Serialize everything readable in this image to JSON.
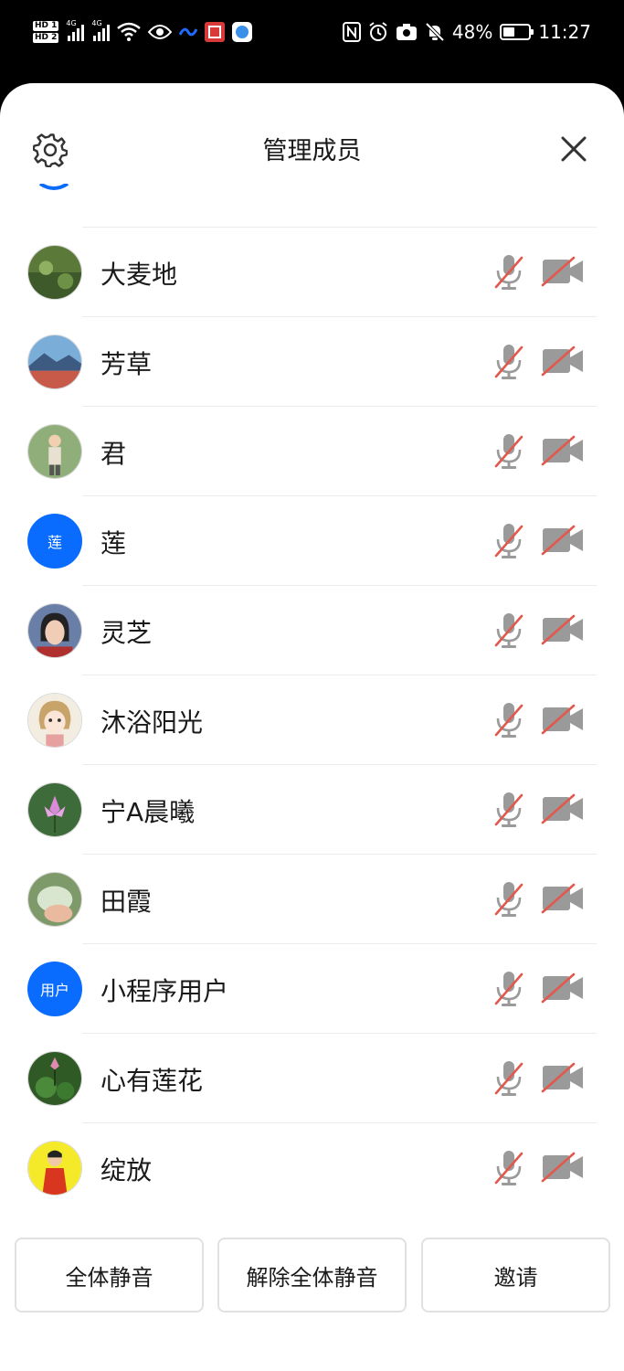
{
  "status_bar": {
    "hd1": "HD 1",
    "hd2": "HD 2",
    "net1": "4G",
    "net2": "4G",
    "battery": "48%",
    "battery_level": 0.48,
    "time": "11:27",
    "icons": [
      "wifi-icon",
      "eye-icon",
      "nfc-icon",
      "alarm-icon",
      "camera-icon",
      "mute-bell-icon"
    ]
  },
  "sheet": {
    "title": "管理成员",
    "settings_icon": "gear-icon",
    "close_icon": "close-icon"
  },
  "members": [
    {
      "name": "大麦地",
      "avatar": "photo",
      "avatar_text": ""
    },
    {
      "name": "芳草",
      "avatar": "photo",
      "avatar_text": ""
    },
    {
      "name": "君",
      "avatar": "photo",
      "avatar_text": ""
    },
    {
      "name": "莲",
      "avatar": "text",
      "avatar_text": "莲"
    },
    {
      "name": "灵芝",
      "avatar": "photo",
      "avatar_text": ""
    },
    {
      "name": "沐浴阳光",
      "avatar": "photo",
      "avatar_text": ""
    },
    {
      "name": "宁A晨曦",
      "avatar": "photo",
      "avatar_text": ""
    },
    {
      "name": "田霞",
      "avatar": "photo",
      "avatar_text": ""
    },
    {
      "name": "小程序用户",
      "avatar": "text",
      "avatar_text": "用户"
    },
    {
      "name": "心有莲花",
      "avatar": "photo",
      "avatar_text": ""
    },
    {
      "name": "绽放",
      "avatar": "photo",
      "avatar_text": ""
    }
  ],
  "footer": {
    "mute_all": "全体静音",
    "unmute_all": "解除全体静音",
    "invite": "邀请"
  },
  "colors": {
    "accent_blue": "#0a6cff",
    "mute_slash": "#e2584c",
    "icon_grey": "#9a9a9a"
  }
}
